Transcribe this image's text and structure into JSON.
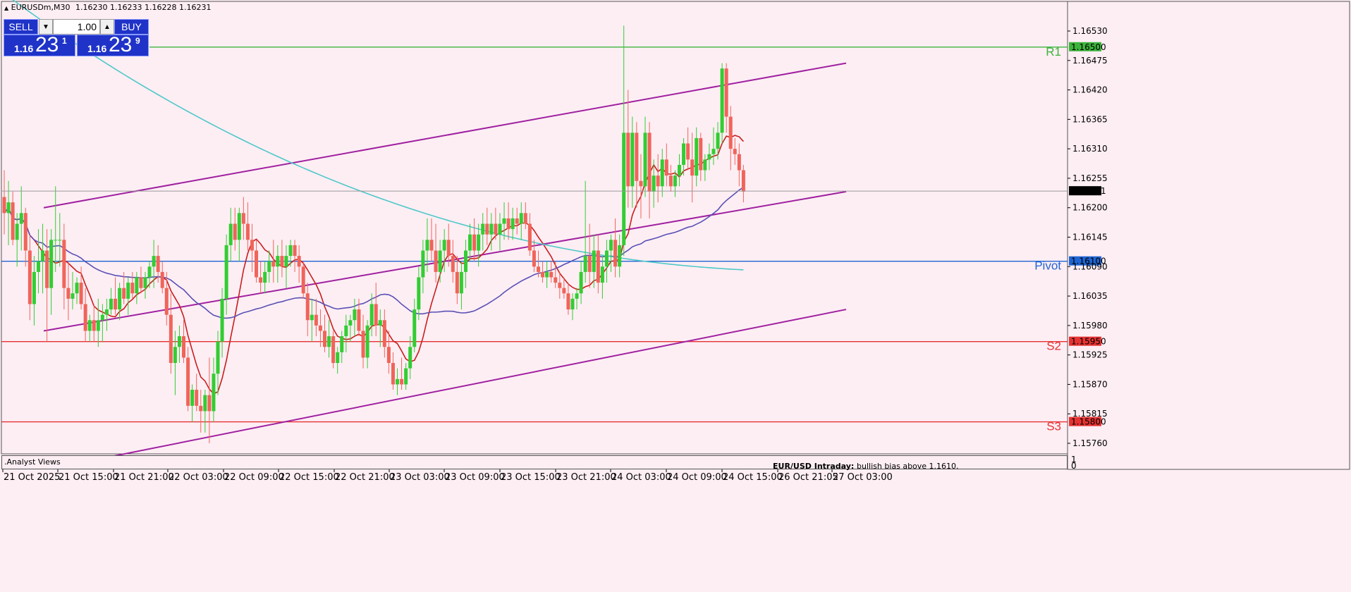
{
  "header": {
    "symbol_info": "EURUSDm,M30",
    "ohlc": "1.16230 1.16233 1.16228 1.16231"
  },
  "trade_panel": {
    "sell_label": "SELL",
    "buy_label": "BUY",
    "lot_value": "1.00",
    "sell_price": {
      "base": "1.16",
      "big": "23",
      "sup": "1"
    },
    "buy_price": {
      "base": "1.16",
      "big": "23",
      "sup": "9"
    }
  },
  "colors": {
    "background": "#fdeef4",
    "bull_candle": "#32cd32",
    "bear_candle": "#f0645a",
    "channel": "#a020a0",
    "ma_fast": "#c81e1e",
    "ma_mid": "#5a50b4",
    "ma_slow": "#4ec8c8",
    "pivot": "#1e64d2",
    "support": "#e63232",
    "resistance": "#3cb43c"
  },
  "chart_data": {
    "type": "candlestick",
    "symbol": "EURUSDm",
    "timeframe": "M30",
    "ylim": [
      1.1571,
      1.1658
    ],
    "price_ticks": [
      "1.16530",
      "1.16475",
      "1.16420",
      "1.16365",
      "1.16310",
      "1.16255",
      "1.16200",
      "1.16145",
      "1.16090",
      "1.16035",
      "1.15980",
      "1.15925",
      "1.15870",
      "1.15815",
      "1.15760"
    ],
    "time_ticks": [
      "21 Oct 2025",
      "21 Oct 15:00",
      "21 Oct 21:00",
      "22 Oct 03:00",
      "22 Oct 09:00",
      "22 Oct 15:00",
      "22 Oct 21:00",
      "23 Oct 03:00",
      "23 Oct 09:00",
      "23 Oct 15:00",
      "23 Oct 21:00",
      "24 Oct 03:00",
      "24 Oct 09:00",
      "24 Oct 15:00",
      "26 Oct 21:05",
      "27 Oct 03:00"
    ],
    "current_price": "1.16231",
    "levels": [
      {
        "name": "R1",
        "value": 1.165,
        "label": "1.16500",
        "color": "#3cb43c"
      },
      {
        "name": "Pivot",
        "value": 1.161,
        "label": "1.16100",
        "color": "#1e64d2"
      },
      {
        "name": "S2",
        "value": 1.1595,
        "label": "1.15950",
        "color": "#e63232"
      },
      {
        "name": "S3",
        "value": 1.158,
        "label": "1.15800",
        "color": "#e63232"
      }
    ],
    "channel_lines": [
      {
        "from": [
          0,
          1.162
        ],
        "to": [
          194,
          1.1647
        ]
      },
      {
        "from": [
          0,
          1.1597
        ],
        "to": [
          194,
          1.1623
        ]
      },
      {
        "from": [
          0,
          1.1571
        ],
        "to": [
          194,
          1.1601
        ]
      }
    ],
    "candles": [
      {
        "o": 1.1622,
        "h": 1.1627,
        "l": 1.1615,
        "c": 1.1619
      },
      {
        "o": 1.1619,
        "h": 1.1625,
        "l": 1.1613,
        "c": 1.1621
      },
      {
        "o": 1.1621,
        "h": 1.1623,
        "l": 1.1613,
        "c": 1.1614
      },
      {
        "o": 1.1614,
        "h": 1.1619,
        "l": 1.1609,
        "c": 1.1617
      },
      {
        "o": 1.1617,
        "h": 1.1624,
        "l": 1.1612,
        "c": 1.1619
      },
      {
        "o": 1.1619,
        "h": 1.162,
        "l": 1.1609,
        "c": 1.1612
      },
      {
        "o": 1.1612,
        "h": 1.1615,
        "l": 1.1599,
        "c": 1.1602
      },
      {
        "o": 1.1602,
        "h": 1.1611,
        "l": 1.1598,
        "c": 1.1608
      },
      {
        "o": 1.1608,
        "h": 1.1616,
        "l": 1.1604,
        "c": 1.161
      },
      {
        "o": 1.161,
        "h": 1.1617,
        "l": 1.1604,
        "c": 1.1612
      },
      {
        "o": 1.1612,
        "h": 1.1616,
        "l": 1.1595,
        "c": 1.1605
      },
      {
        "o": 1.1605,
        "h": 1.1616,
        "l": 1.16,
        "c": 1.1614
      },
      {
        "o": 1.1614,
        "h": 1.1624,
        "l": 1.1608,
        "c": 1.1614
      },
      {
        "o": 1.1614,
        "h": 1.1619,
        "l": 1.1609,
        "c": 1.1614
      },
      {
        "o": 1.1614,
        "h": 1.1617,
        "l": 1.1601,
        "c": 1.1605
      },
      {
        "o": 1.1605,
        "h": 1.161,
        "l": 1.1599,
        "c": 1.1603
      },
      {
        "o": 1.1603,
        "h": 1.1608,
        "l": 1.1601,
        "c": 1.1604
      },
      {
        "o": 1.1604,
        "h": 1.1607,
        "l": 1.1602,
        "c": 1.1606
      },
      {
        "o": 1.1606,
        "h": 1.1609,
        "l": 1.1601,
        "c": 1.1602
      },
      {
        "o": 1.1602,
        "h": 1.1605,
        "l": 1.1595,
        "c": 1.1597
      },
      {
        "o": 1.1597,
        "h": 1.16,
        "l": 1.1595,
        "c": 1.1599
      },
      {
        "o": 1.1599,
        "h": 1.1602,
        "l": 1.1595,
        "c": 1.1597
      },
      {
        "o": 1.1597,
        "h": 1.1603,
        "l": 1.1594,
        "c": 1.1599
      },
      {
        "o": 1.1599,
        "h": 1.1602,
        "l": 1.1595,
        "c": 1.16
      },
      {
        "o": 1.16,
        "h": 1.1603,
        "l": 1.1597,
        "c": 1.1601
      },
      {
        "o": 1.1601,
        "h": 1.1605,
        "l": 1.16,
        "c": 1.1603
      },
      {
        "o": 1.1603,
        "h": 1.1607,
        "l": 1.16,
        "c": 1.1601
      },
      {
        "o": 1.1601,
        "h": 1.1606,
        "l": 1.1599,
        "c": 1.1605
      },
      {
        "o": 1.1605,
        "h": 1.1608,
        "l": 1.1602,
        "c": 1.1603
      },
      {
        "o": 1.1603,
        "h": 1.1607,
        "l": 1.16,
        "c": 1.1606
      },
      {
        "o": 1.1606,
        "h": 1.1608,
        "l": 1.1603,
        "c": 1.1604
      },
      {
        "o": 1.1604,
        "h": 1.1608,
        "l": 1.1602,
        "c": 1.1607
      },
      {
        "o": 1.1607,
        "h": 1.1609,
        "l": 1.1604,
        "c": 1.1605
      },
      {
        "o": 1.1605,
        "h": 1.1608,
        "l": 1.1603,
        "c": 1.1607
      },
      {
        "o": 1.1607,
        "h": 1.161,
        "l": 1.1605,
        "c": 1.1609
      },
      {
        "o": 1.1609,
        "h": 1.1614,
        "l": 1.1605,
        "c": 1.1611
      },
      {
        "o": 1.1611,
        "h": 1.1613,
        "l": 1.1606,
        "c": 1.1608
      },
      {
        "o": 1.1608,
        "h": 1.161,
        "l": 1.1604,
        "c": 1.1605
      },
      {
        "o": 1.1605,
        "h": 1.1608,
        "l": 1.1598,
        "c": 1.16
      },
      {
        "o": 1.16,
        "h": 1.1604,
        "l": 1.1589,
        "c": 1.1591
      },
      {
        "o": 1.1591,
        "h": 1.1597,
        "l": 1.1585,
        "c": 1.1594
      },
      {
        "o": 1.1594,
        "h": 1.1598,
        "l": 1.1591,
        "c": 1.1596
      },
      {
        "o": 1.1596,
        "h": 1.1599,
        "l": 1.1591,
        "c": 1.1592
      },
      {
        "o": 1.1592,
        "h": 1.1594,
        "l": 1.1582,
        "c": 1.1583
      },
      {
        "o": 1.1583,
        "h": 1.1587,
        "l": 1.158,
        "c": 1.1586
      },
      {
        "o": 1.1586,
        "h": 1.1589,
        "l": 1.1582,
        "c": 1.1583
      },
      {
        "o": 1.1583,
        "h": 1.1586,
        "l": 1.1578,
        "c": 1.1582
      },
      {
        "o": 1.1582,
        "h": 1.1586,
        "l": 1.1578,
        "c": 1.1585
      },
      {
        "o": 1.1585,
        "h": 1.1592,
        "l": 1.1576,
        "c": 1.1582
      },
      {
        "o": 1.1582,
        "h": 1.1592,
        "l": 1.158,
        "c": 1.1589
      },
      {
        "o": 1.1589,
        "h": 1.1597,
        "l": 1.1585,
        "c": 1.1595
      },
      {
        "o": 1.1595,
        "h": 1.1605,
        "l": 1.1592,
        "c": 1.1603
      },
      {
        "o": 1.1603,
        "h": 1.1615,
        "l": 1.16,
        "c": 1.1613
      },
      {
        "o": 1.1613,
        "h": 1.162,
        "l": 1.161,
        "c": 1.1617
      },
      {
        "o": 1.1617,
        "h": 1.162,
        "l": 1.1612,
        "c": 1.1614
      },
      {
        "o": 1.1614,
        "h": 1.162,
        "l": 1.161,
        "c": 1.1619
      },
      {
        "o": 1.1619,
        "h": 1.1622,
        "l": 1.1614,
        "c": 1.1617
      },
      {
        "o": 1.1617,
        "h": 1.1621,
        "l": 1.1612,
        "c": 1.1614
      },
      {
        "o": 1.1614,
        "h": 1.1617,
        "l": 1.1608,
        "c": 1.1612
      },
      {
        "o": 1.1612,
        "h": 1.1614,
        "l": 1.1606,
        "c": 1.1607
      },
      {
        "o": 1.1607,
        "h": 1.161,
        "l": 1.1604,
        "c": 1.1606
      },
      {
        "o": 1.1606,
        "h": 1.161,
        "l": 1.1604,
        "c": 1.1608
      },
      {
        "o": 1.1608,
        "h": 1.1612,
        "l": 1.1606,
        "c": 1.161
      },
      {
        "o": 1.161,
        "h": 1.1614,
        "l": 1.1606,
        "c": 1.1609
      },
      {
        "o": 1.1609,
        "h": 1.1613,
        "l": 1.1606,
        "c": 1.1611
      },
      {
        "o": 1.1611,
        "h": 1.1614,
        "l": 1.1607,
        "c": 1.1609
      },
      {
        "o": 1.1609,
        "h": 1.1613,
        "l": 1.1605,
        "c": 1.1611
      },
      {
        "o": 1.1611,
        "h": 1.1614,
        "l": 1.1609,
        "c": 1.1613
      },
      {
        "o": 1.1613,
        "h": 1.1614,
        "l": 1.1608,
        "c": 1.1611
      },
      {
        "o": 1.1611,
        "h": 1.1613,
        "l": 1.1606,
        "c": 1.1609
      },
      {
        "o": 1.1609,
        "h": 1.161,
        "l": 1.1603,
        "c": 1.1604
      },
      {
        "o": 1.1604,
        "h": 1.1606,
        "l": 1.1596,
        "c": 1.1599
      },
      {
        "o": 1.1599,
        "h": 1.1603,
        "l": 1.1595,
        "c": 1.16
      },
      {
        "o": 1.16,
        "h": 1.1603,
        "l": 1.1596,
        "c": 1.1598
      },
      {
        "o": 1.1598,
        "h": 1.1601,
        "l": 1.1594,
        "c": 1.1597
      },
      {
        "o": 1.1597,
        "h": 1.16,
        "l": 1.1593,
        "c": 1.1594
      },
      {
        "o": 1.1594,
        "h": 1.1599,
        "l": 1.1592,
        "c": 1.1596
      },
      {
        "o": 1.1596,
        "h": 1.1597,
        "l": 1.159,
        "c": 1.1591
      },
      {
        "o": 1.1591,
        "h": 1.1594,
        "l": 1.1589,
        "c": 1.1593
      },
      {
        "o": 1.1593,
        "h": 1.1597,
        "l": 1.1591,
        "c": 1.1596
      },
      {
        "o": 1.1596,
        "h": 1.16,
        "l": 1.1593,
        "c": 1.1598
      },
      {
        "o": 1.1598,
        "h": 1.16,
        "l": 1.1595,
        "c": 1.1599
      },
      {
        "o": 1.1599,
        "h": 1.1603,
        "l": 1.1596,
        "c": 1.1601
      },
      {
        "o": 1.1601,
        "h": 1.1603,
        "l": 1.1596,
        "c": 1.1597
      },
      {
        "o": 1.1597,
        "h": 1.16,
        "l": 1.159,
        "c": 1.1592
      },
      {
        "o": 1.1592,
        "h": 1.1599,
        "l": 1.159,
        "c": 1.1598
      },
      {
        "o": 1.1598,
        "h": 1.1604,
        "l": 1.1596,
        "c": 1.1602
      },
      {
        "o": 1.1602,
        "h": 1.1606,
        "l": 1.1596,
        "c": 1.1598
      },
      {
        "o": 1.1598,
        "h": 1.1601,
        "l": 1.1594,
        "c": 1.1599
      },
      {
        "o": 1.1599,
        "h": 1.1601,
        "l": 1.1592,
        "c": 1.1594
      },
      {
        "o": 1.1594,
        "h": 1.1597,
        "l": 1.1589,
        "c": 1.1591
      },
      {
        "o": 1.1591,
        "h": 1.1593,
        "l": 1.1586,
        "c": 1.1587
      },
      {
        "o": 1.1587,
        "h": 1.159,
        "l": 1.1585,
        "c": 1.1588
      },
      {
        "o": 1.1588,
        "h": 1.1592,
        "l": 1.1586,
        "c": 1.1587
      },
      {
        "o": 1.1587,
        "h": 1.1591,
        "l": 1.1586,
        "c": 1.159
      },
      {
        "o": 1.159,
        "h": 1.1596,
        "l": 1.1588,
        "c": 1.1594
      },
      {
        "o": 1.1594,
        "h": 1.1603,
        "l": 1.1593,
        "c": 1.1601
      },
      {
        "o": 1.1601,
        "h": 1.1609,
        "l": 1.1599,
        "c": 1.1607
      },
      {
        "o": 1.1607,
        "h": 1.1614,
        "l": 1.1604,
        "c": 1.1612
      },
      {
        "o": 1.1612,
        "h": 1.1618,
        "l": 1.1608,
        "c": 1.1614
      },
      {
        "o": 1.1614,
        "h": 1.1618,
        "l": 1.161,
        "c": 1.1612
      },
      {
        "o": 1.1612,
        "h": 1.1617,
        "l": 1.1606,
        "c": 1.1608
      },
      {
        "o": 1.1608,
        "h": 1.1614,
        "l": 1.1606,
        "c": 1.1612
      },
      {
        "o": 1.1612,
        "h": 1.1616,
        "l": 1.1608,
        "c": 1.1614
      },
      {
        "o": 1.1614,
        "h": 1.1617,
        "l": 1.1609,
        "c": 1.1611
      },
      {
        "o": 1.1611,
        "h": 1.1614,
        "l": 1.1606,
        "c": 1.1608
      },
      {
        "o": 1.1608,
        "h": 1.1611,
        "l": 1.1602,
        "c": 1.1604
      },
      {
        "o": 1.1604,
        "h": 1.161,
        "l": 1.1601,
        "c": 1.1608
      },
      {
        "o": 1.1608,
        "h": 1.1614,
        "l": 1.1605,
        "c": 1.1612
      },
      {
        "o": 1.1612,
        "h": 1.1617,
        "l": 1.161,
        "c": 1.1615
      },
      {
        "o": 1.1615,
        "h": 1.1618,
        "l": 1.161,
        "c": 1.1612
      },
      {
        "o": 1.1612,
        "h": 1.1617,
        "l": 1.1609,
        "c": 1.1615
      },
      {
        "o": 1.1615,
        "h": 1.1619,
        "l": 1.1612,
        "c": 1.1617
      },
      {
        "o": 1.1617,
        "h": 1.162,
        "l": 1.1613,
        "c": 1.1615
      },
      {
        "o": 1.1615,
        "h": 1.1619,
        "l": 1.1612,
        "c": 1.1617
      },
      {
        "o": 1.1617,
        "h": 1.162,
        "l": 1.1614,
        "c": 1.1615
      },
      {
        "o": 1.1615,
        "h": 1.1619,
        "l": 1.1612,
        "c": 1.1617
      },
      {
        "o": 1.1617,
        "h": 1.1621,
        "l": 1.1614,
        "c": 1.1618
      },
      {
        "o": 1.1618,
        "h": 1.1621,
        "l": 1.1614,
        "c": 1.1616
      },
      {
        "o": 1.1616,
        "h": 1.162,
        "l": 1.1614,
        "c": 1.1618
      },
      {
        "o": 1.1618,
        "h": 1.162,
        "l": 1.1615,
        "c": 1.1617
      },
      {
        "o": 1.1617,
        "h": 1.1621,
        "l": 1.1614,
        "c": 1.1619
      },
      {
        "o": 1.1619,
        "h": 1.1621,
        "l": 1.1616,
        "c": 1.1617
      },
      {
        "o": 1.1617,
        "h": 1.1619,
        "l": 1.1611,
        "c": 1.1612
      },
      {
        "o": 1.1612,
        "h": 1.1614,
        "l": 1.1608,
        "c": 1.1609
      },
      {
        "o": 1.1609,
        "h": 1.1612,
        "l": 1.1607,
        "c": 1.1608
      },
      {
        "o": 1.1608,
        "h": 1.161,
        "l": 1.1606,
        "c": 1.1607
      },
      {
        "o": 1.1607,
        "h": 1.161,
        "l": 1.1605,
        "c": 1.1608
      },
      {
        "o": 1.1608,
        "h": 1.161,
        "l": 1.1606,
        "c": 1.1607
      },
      {
        "o": 1.1607,
        "h": 1.161,
        "l": 1.1605,
        "c": 1.1606
      },
      {
        "o": 1.1606,
        "h": 1.1608,
        "l": 1.1603,
        "c": 1.1605
      },
      {
        "o": 1.1605,
        "h": 1.1607,
        "l": 1.1603,
        "c": 1.1604
      },
      {
        "o": 1.1604,
        "h": 1.1606,
        "l": 1.16,
        "c": 1.1601
      },
      {
        "o": 1.1601,
        "h": 1.1604,
        "l": 1.1599,
        "c": 1.1603
      },
      {
        "o": 1.1603,
        "h": 1.1605,
        "l": 1.1601,
        "c": 1.1604
      },
      {
        "o": 1.1604,
        "h": 1.161,
        "l": 1.1602,
        "c": 1.1608
      },
      {
        "o": 1.1608,
        "h": 1.1625,
        "l": 1.1606,
        "c": 1.1611
      },
      {
        "o": 1.1611,
        "h": 1.1617,
        "l": 1.1605,
        "c": 1.1608
      },
      {
        "o": 1.1608,
        "h": 1.1615,
        "l": 1.1605,
        "c": 1.1612
      },
      {
        "o": 1.1612,
        "h": 1.1615,
        "l": 1.1604,
        "c": 1.1606
      },
      {
        "o": 1.1606,
        "h": 1.1611,
        "l": 1.1603,
        "c": 1.1609
      },
      {
        "o": 1.1609,
        "h": 1.1614,
        "l": 1.1606,
        "c": 1.1612
      },
      {
        "o": 1.1612,
        "h": 1.1615,
        "l": 1.1608,
        "c": 1.1614
      },
      {
        "o": 1.1614,
        "h": 1.1618,
        "l": 1.1607,
        "c": 1.1609
      },
      {
        "o": 1.1609,
        "h": 1.1615,
        "l": 1.1607,
        "c": 1.1613
      },
      {
        "o": 1.1613,
        "h": 1.1654,
        "l": 1.1611,
        "c": 1.1634
      },
      {
        "o": 1.1634,
        "h": 1.1642,
        "l": 1.162,
        "c": 1.1624
      },
      {
        "o": 1.1624,
        "h": 1.1637,
        "l": 1.162,
        "c": 1.1634
      },
      {
        "o": 1.1634,
        "h": 1.1636,
        "l": 1.162,
        "c": 1.1625
      },
      {
        "o": 1.1625,
        "h": 1.163,
        "l": 1.1618,
        "c": 1.1624
      },
      {
        "o": 1.1624,
        "h": 1.1637,
        "l": 1.1622,
        "c": 1.1634
      },
      {
        "o": 1.1634,
        "h": 1.1636,
        "l": 1.1618,
        "c": 1.1623
      },
      {
        "o": 1.1623,
        "h": 1.1629,
        "l": 1.162,
        "c": 1.1626
      },
      {
        "o": 1.1626,
        "h": 1.163,
        "l": 1.1621,
        "c": 1.1624
      },
      {
        "o": 1.1624,
        "h": 1.1631,
        "l": 1.1622,
        "c": 1.1629
      },
      {
        "o": 1.1629,
        "h": 1.1632,
        "l": 1.1624,
        "c": 1.1626
      },
      {
        "o": 1.1626,
        "h": 1.1628,
        "l": 1.1623,
        "c": 1.1624
      },
      {
        "o": 1.1624,
        "h": 1.1627,
        "l": 1.1622,
        "c": 1.1626
      },
      {
        "o": 1.1626,
        "h": 1.163,
        "l": 1.1624,
        "c": 1.1628
      },
      {
        "o": 1.1628,
        "h": 1.1633,
        "l": 1.1626,
        "c": 1.1632
      },
      {
        "o": 1.1632,
        "h": 1.1635,
        "l": 1.1627,
        "c": 1.1629
      },
      {
        "o": 1.1629,
        "h": 1.1634,
        "l": 1.1621,
        "c": 1.1626
      },
      {
        "o": 1.1626,
        "h": 1.1635,
        "l": 1.1624,
        "c": 1.1633
      },
      {
        "o": 1.1633,
        "h": 1.1634,
        "l": 1.1625,
        "c": 1.1627
      },
      {
        "o": 1.1627,
        "h": 1.163,
        "l": 1.1625,
        "c": 1.1629
      },
      {
        "o": 1.1629,
        "h": 1.1632,
        "l": 1.1627,
        "c": 1.163
      },
      {
        "o": 1.163,
        "h": 1.1635,
        "l": 1.1628,
        "c": 1.1631
      },
      {
        "o": 1.1631,
        "h": 1.1636,
        "l": 1.1629,
        "c": 1.1634
      },
      {
        "o": 1.1634,
        "h": 1.1647,
        "l": 1.1632,
        "c": 1.1646
      },
      {
        "o": 1.1646,
        "h": 1.1647,
        "l": 1.1634,
        "c": 1.1637
      },
      {
        "o": 1.1637,
        "h": 1.1639,
        "l": 1.1627,
        "c": 1.1631
      },
      {
        "o": 1.1631,
        "h": 1.1633,
        "l": 1.1628,
        "c": 1.163
      },
      {
        "o": 1.163,
        "h": 1.1632,
        "l": 1.1624,
        "c": 1.1627
      },
      {
        "o": 1.1627,
        "h": 1.1628,
        "l": 1.1621,
        "c": 1.1623
      }
    ],
    "analyst_panel": {
      "title": ".Analyst Views",
      "message_title": "EUR/USD Intraday:",
      "message_text": "bullish bias above 1.1610."
    },
    "subwindow_scale": [
      "1",
      "0"
    ]
  }
}
